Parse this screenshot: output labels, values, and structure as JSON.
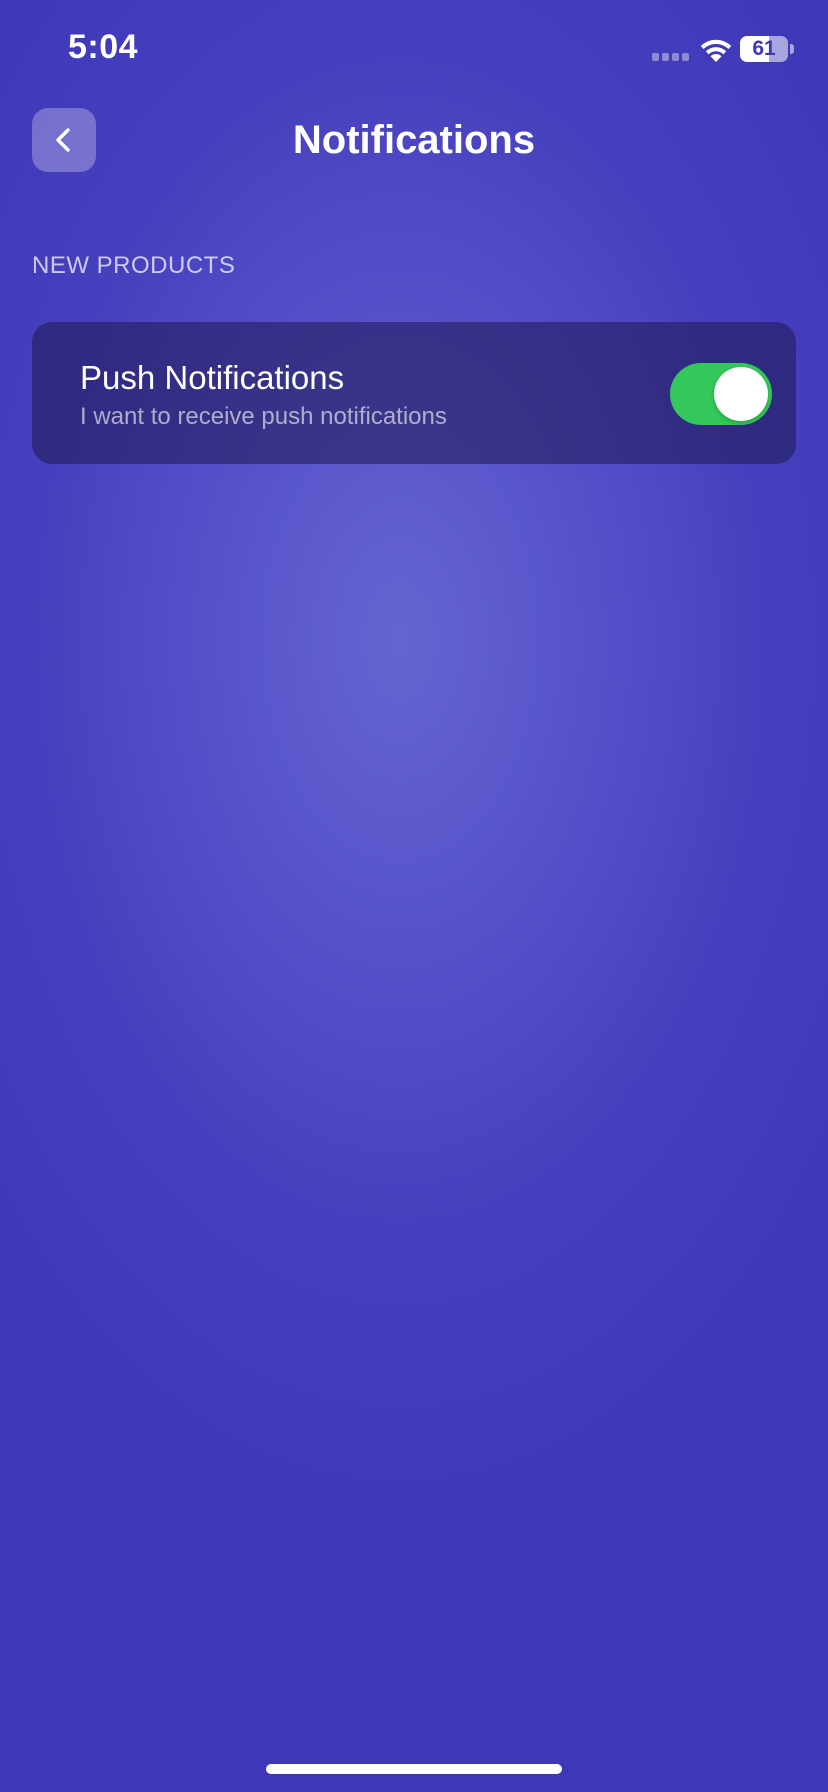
{
  "status_bar": {
    "time": "5:04",
    "battery_level": "61",
    "battery_fraction": 0.61,
    "icons": [
      "signal-icon",
      "wifi-icon",
      "battery-icon"
    ]
  },
  "header": {
    "back_icon": "chevron-left-icon",
    "title": "Notifications"
  },
  "sections": [
    {
      "label": "NEW PRODUCTS",
      "items": [
        {
          "title": "Push Notifications",
          "subtitle": "I want to receive push notifications",
          "enabled": true
        }
      ]
    }
  ],
  "colors": {
    "background": "#4740be",
    "card": "#2e2a6e",
    "toggle_on": "#34c759",
    "text_primary": "#ffffff"
  }
}
